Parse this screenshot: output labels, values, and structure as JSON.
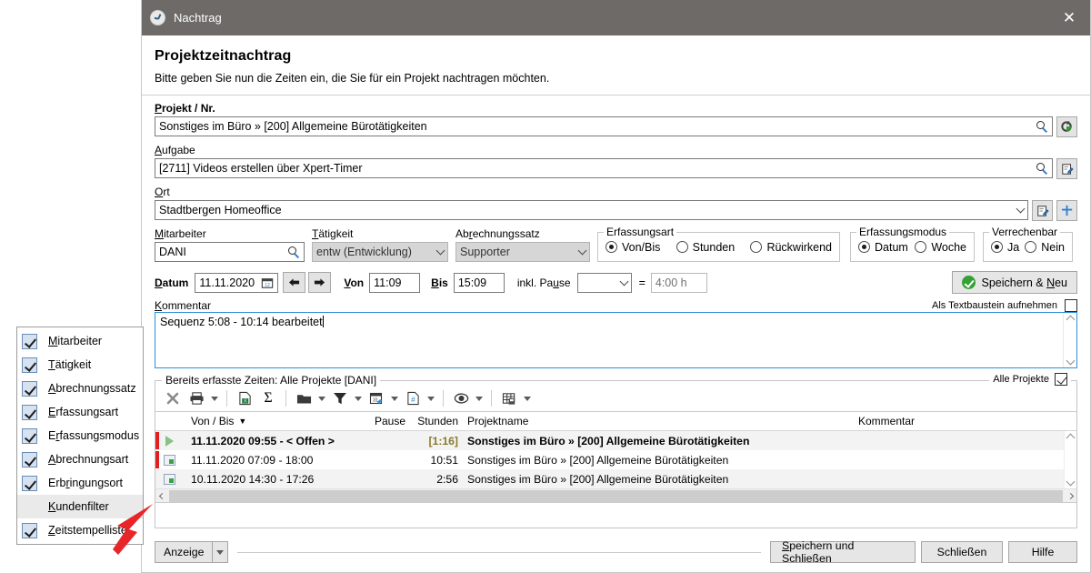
{
  "window": {
    "title": "Nachtrag",
    "icon": "clock-icon",
    "close_label": "✕"
  },
  "header": {
    "heading": "Projektzeitnachtrag",
    "subheading": "Bitte geben Sie nun die Zeiten ein, die Sie für ein Projekt nachtragen möchten."
  },
  "fields": {
    "projekt": {
      "label_u": "P",
      "label_rest": "rojekt / Nr.",
      "value": "Sonstiges im Büro » [200] Allgemeine Bürotätigkeiten"
    },
    "aufgabe": {
      "label_u": "A",
      "label_rest": "ufgabe",
      "value": "[2711] Videos erstellen über Xpert-Timer"
    },
    "ort": {
      "label_u": "O",
      "label_rest": "rt",
      "value": "Stadtbergen Homeoffice"
    },
    "mitarbeiter": {
      "label_u": "M",
      "label_rest": "itarbeiter",
      "value": "DANI"
    },
    "taetigkeit": {
      "label_u": "T",
      "label_rest": "ätigkeit",
      "value": "entw (Entwicklung)"
    },
    "abrechnungssatz": {
      "label_pre": "Ab",
      "label_u": "r",
      "label_rest": "echnungssatz",
      "value": "Supporter"
    },
    "datum": {
      "label_u": "D",
      "label_rest": "atum",
      "value": "11.11.2020"
    },
    "von": {
      "label_u": "V",
      "label_rest": "on",
      "value": "11:09"
    },
    "bis": {
      "label_u": "B",
      "label_rest": "is",
      "value": "15:09"
    },
    "pause": {
      "label_pre": "inkl. Pa",
      "label_u": "u",
      "label_rest": "se",
      "value": ""
    },
    "equals": "=",
    "result": {
      "value": "4:00 h"
    },
    "kommentar": {
      "label_u": "K",
      "label_rest": "ommentar",
      "value": "Sequenz 5:08 - 10:14 bearbeitet"
    }
  },
  "groups": {
    "erfassungsart": {
      "caption": "Erfassungsart",
      "options": [
        {
          "label": "Von/Bis",
          "selected": true
        },
        {
          "label": "Stunden",
          "selected": false
        },
        {
          "label": "Rückwirkend",
          "selected": false
        }
      ]
    },
    "erfassungsmodus": {
      "caption": "Erfassungsmodus",
      "options": [
        {
          "label": "Datum",
          "selected": true
        },
        {
          "label": "Woche",
          "selected": false
        }
      ]
    },
    "verrechenbar": {
      "caption": "Verrechenbar",
      "options": [
        {
          "label": "Ja",
          "selected": true
        },
        {
          "label": "Nein",
          "selected": false
        }
      ]
    }
  },
  "save_new": {
    "label_pre": "Speichern & ",
    "label_u": "N",
    "label_rest": "eu",
    "icon": "check-circle-icon"
  },
  "textbaustein": {
    "label": "Als Textbaustein aufnehmen",
    "checked": false
  },
  "times_group": {
    "caption": "Bereits erfasste Zeiten: Alle Projekte [DANI]",
    "all_projects_label": "Alle Projekte",
    "all_projects_checked": true
  },
  "toolbar": {
    "items": [
      {
        "icon": "delete-x-icon",
        "dropdown": false
      },
      {
        "icon": "print-icon",
        "dropdown": true
      },
      {
        "icon": "excel-export-icon",
        "dropdown": false
      },
      {
        "icon": "sum-sigma-icon",
        "dropdown": false
      },
      {
        "icon": "folder-icon",
        "dropdown": true
      },
      {
        "icon": "filter-funnel-icon",
        "dropdown": true
      },
      {
        "icon": "calendar-icon",
        "dropdown": true
      },
      {
        "icon": "document-number-icon",
        "dropdown": true
      },
      {
        "icon": "eye-icon",
        "dropdown": true
      },
      {
        "icon": "grid-save-icon",
        "dropdown": true
      }
    ]
  },
  "table": {
    "columns": [
      "Von / Bis",
      "Pause",
      "Stunden",
      "Projektname",
      "Kommentar"
    ],
    "sort_column": "Von / Bis",
    "sort_indicator": "▼",
    "rows": [
      {
        "icon": "running-timer-icon",
        "von_bis": "11.11.2020   09:55 - < Offen >",
        "pause": "",
        "stunden": "[1:16]",
        "projektname": "Sonstiges im Büro » [200] Allgemeine Bürotätigkeiten",
        "kommentar": "",
        "bold": true
      },
      {
        "icon": "stamped-entry-icon",
        "von_bis": "11.11.2020   07:09 - 18:00",
        "pause": "",
        "stunden": "10:51",
        "projektname": "Sonstiges im Büro » [200] Allgemeine Bürotätigkeiten",
        "kommentar": "",
        "bold": false
      },
      {
        "icon": "stamped-entry-icon",
        "von_bis": "10.11.2020   14:30 - 17:26",
        "pause": "",
        "stunden": "2:56",
        "projektname": "Sonstiges im Büro » [200] Allgemeine Bürotätigkeiten",
        "kommentar": "",
        "bold": false
      }
    ]
  },
  "footer": {
    "anzeige": {
      "label": "Anzeige"
    },
    "speichern_schliessen": {
      "label_pre": "",
      "label_u": "S",
      "label_rest": "peichern und Schließen"
    },
    "schliessen": {
      "label": "Schließen"
    },
    "hilfe": {
      "label": "Hilfe"
    }
  },
  "context_menu": {
    "items": [
      {
        "label_u": "M",
        "label_rest": "itarbeiter",
        "checked": true,
        "highlighted": false
      },
      {
        "label_u": "T",
        "label_rest": "ätigkeit",
        "checked": true,
        "highlighted": false
      },
      {
        "label_u": "A",
        "label_rest": "brechnungssatz",
        "checked": true,
        "highlighted": false
      },
      {
        "label_u": "E",
        "label_rest": "rfassungsart",
        "checked": true,
        "highlighted": false
      },
      {
        "label_pre": "E",
        "label_u": "r",
        "label_rest": "fassungsmodus",
        "checked": true,
        "highlighted": false
      },
      {
        "label_u": "A",
        "label_pre2": "b",
        "label_rest": "rechnungsart",
        "checked": true,
        "highlighted": false
      },
      {
        "label_pre": "Erb",
        "label_u": "r",
        "label_rest": "ingungsort",
        "checked": true,
        "highlighted": false
      },
      {
        "label_u": "K",
        "label_rest": "undenfilter",
        "checked": false,
        "highlighted": true
      },
      {
        "label_u": "Z",
        "label_rest": "eitstempelliste",
        "checked": true,
        "highlighted": false
      }
    ]
  },
  "colors": {
    "titlebar": "#6d6a67",
    "accent_focus": "#2e8fd8",
    "row_marker": "#e02020",
    "success": "#35a035",
    "highlight_row": "#f3f3f3"
  }
}
